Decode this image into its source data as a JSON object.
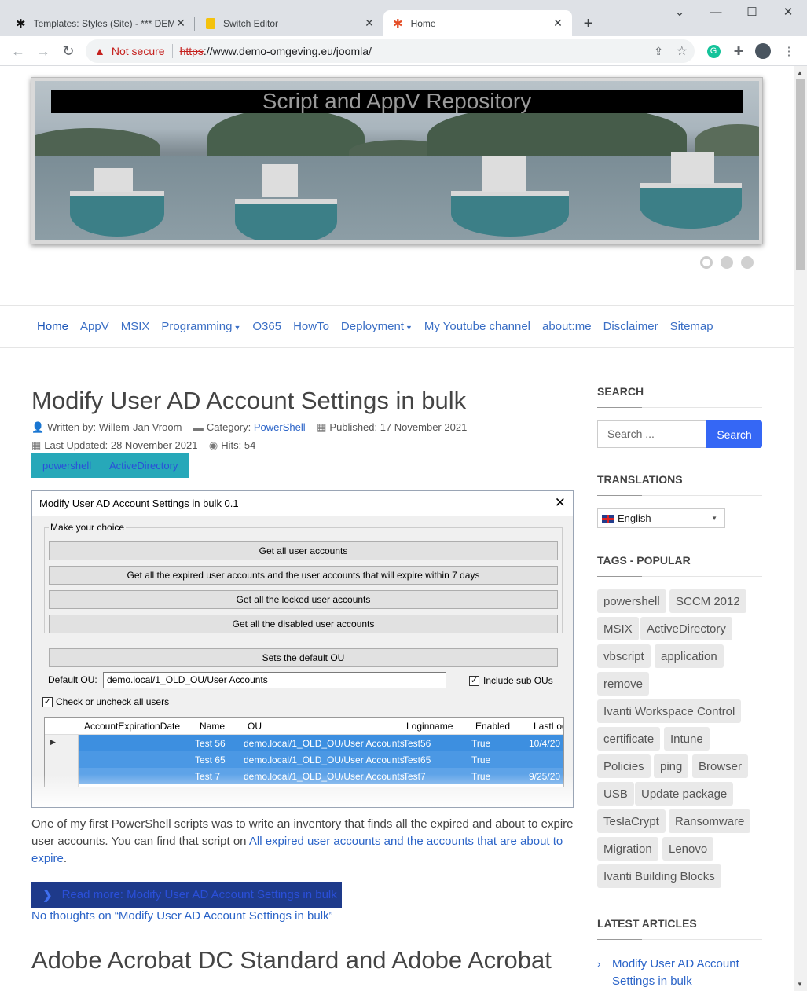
{
  "browser": {
    "tabs": [
      {
        "title": "Templates: Styles (Site) - *** DEM"
      },
      {
        "title": "Switch Editor"
      },
      {
        "title": "Home"
      }
    ],
    "not_secure": "Not secure",
    "url_scheme": "https",
    "url_rest": "://www.demo-omgeving.eu/joomla/"
  },
  "banner": {
    "title": "Script and AppV Repository"
  },
  "menu": {
    "items": [
      "Home",
      "AppV",
      "MSIX",
      "Programming",
      "O365",
      "HowTo",
      "Deployment",
      "My Youtube channel",
      "about:me",
      "Disclaimer",
      "Sitemap"
    ]
  },
  "article1": {
    "title": "Modify User AD Account Settings in bulk",
    "written_by_label": "Written by:",
    "author": "Willem-Jan Vroom",
    "category_label": "Category:",
    "category": "PowerShell",
    "published": "Published: 17 November 2021",
    "updated": "Last Updated: 28 November 2021",
    "hits": "Hits: 54",
    "tags": [
      "powershell",
      "ActiveDirectory"
    ],
    "para1": "One of my first PowerShell scripts was to write an inventory that finds all the expired and about to expire user accounts. You can find that script on ",
    "para_link": "All expired user accounts and the accounts that are about to expire",
    "para_end": ".",
    "read_more": "Read more: Modify User AD Account Settings in bulk",
    "thoughts": "No thoughts on “Modify User AD Account Settings in bulk”"
  },
  "screenshot": {
    "window_title": "Modify User AD Account Settings in bulk 0.1",
    "group_label": "Make your choice",
    "buttons": [
      "Get all user accounts",
      "Get all the expired user accounts and the user accounts that will expire within 7 days",
      "Get all the locked user accounts",
      "Get all the disabled user accounts"
    ],
    "default_ou_button": "Sets the default OU",
    "default_ou_label": "Default OU:",
    "default_ou_value": "demo.local/1_OLD_OU/User Accounts",
    "include_sub": "Include sub OUs",
    "check_all": "Check or uncheck all users",
    "columns": [
      "AccountExpirationDate",
      "Name",
      "OU",
      "Loginname",
      "Enabled",
      "LastLog"
    ],
    "rows": [
      {
        "name": "Test 56",
        "ou": "demo.local/1_OLD_OU/User Accounts",
        "login": "Test56",
        "enabled": "True",
        "last": "10/4/20"
      },
      {
        "name": "Test 65",
        "ou": "demo.local/1_OLD_OU/User Accounts",
        "login": "Test65",
        "enabled": "True",
        "last": ""
      },
      {
        "name": "Test 7",
        "ou": "demo.local/1_OLD_OU/User Accounts",
        "login": "Test7",
        "enabled": "True",
        "last": "9/25/20"
      }
    ]
  },
  "article2": {
    "title": "Adobe Acrobat DC Standard and Adobe Acrobat"
  },
  "sidebar": {
    "search_heading": "SEARCH",
    "search_placeholder": "Search ...",
    "search_button": "Search",
    "translations_heading": "TRANSLATIONS",
    "language": "English",
    "tags_heading": "TAGS - POPULAR",
    "tags": [
      "powershell",
      "SCCM 2012",
      "MSIX",
      "ActiveDirectory",
      "vbscript",
      "application",
      "remove",
      "Ivanti Workspace Control",
      "certificate",
      "Intune",
      "Policies",
      "ping",
      "Browser",
      "USB",
      "Update package",
      "TeslaCrypt",
      "Ransomware",
      "Migration",
      "Lenovo",
      "Ivanti Building Blocks"
    ],
    "latest_heading": "LATEST ARTICLES",
    "latest": [
      "Modify User AD Account Settings in bulk"
    ]
  }
}
